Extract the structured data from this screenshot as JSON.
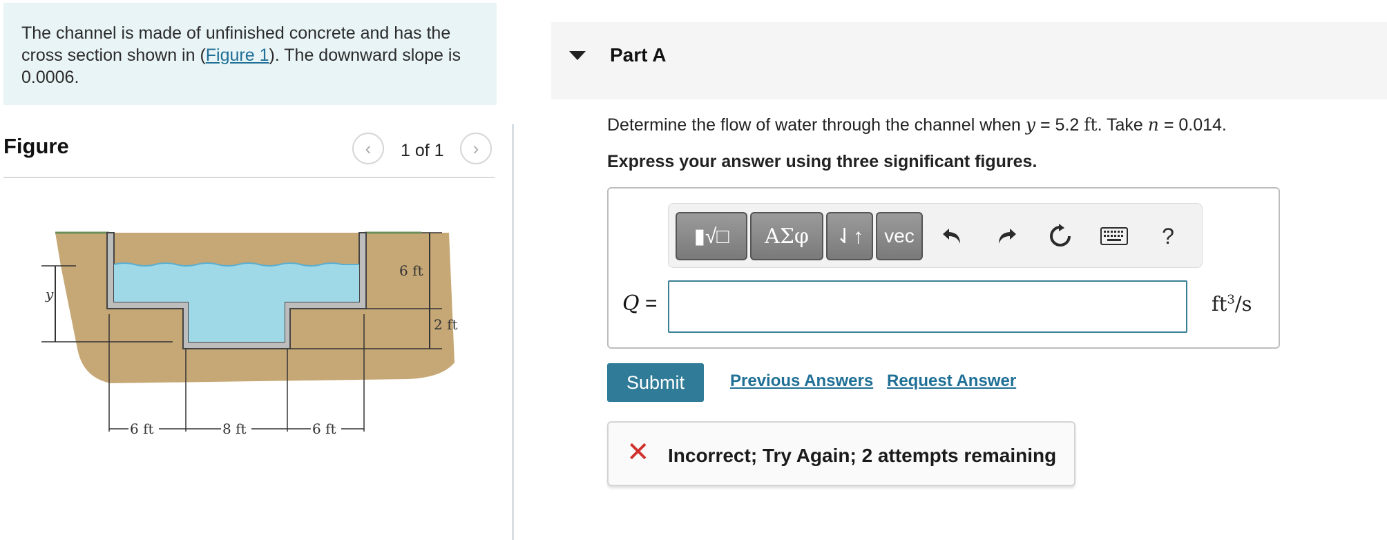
{
  "problem": {
    "text_before": "The channel is made of unfinished concrete and has the cross section shown in (",
    "figure_link": "Figure 1",
    "text_after": "). The downward slope is 0.0006."
  },
  "figure": {
    "title": "Figure",
    "pager": "1 of 1",
    "prev_icon": "‹",
    "next_icon": "›",
    "labels": {
      "y": "y",
      "depth_upper": "6 ft",
      "depth_lower": "2 ft",
      "width_left": "6 ft",
      "width_middle": "8 ft",
      "width_right": "6 ft"
    },
    "colors": {
      "water": "#9fd8e6",
      "soil": "#c6a876",
      "concrete": "#bdbdbd"
    }
  },
  "part": {
    "title": "Part A",
    "question_before": "Determine the flow of water through the channel when ",
    "var_y": "y",
    "eq_y": " = 5.2 ",
    "unit_y": "ft",
    "take": ". Take ",
    "var_n": "n",
    "eq_n": " = 0.014.",
    "instruction": "Express your answer using three significant figures."
  },
  "toolbar": {
    "templates_icon": "▮√□",
    "greek_label": "ΑΣφ",
    "updown_icon": "⇃↑",
    "vec_label": "vec",
    "undo_icon": "undo-icon",
    "redo_icon": "redo-icon",
    "reset_icon": "reset-icon",
    "keyboard_icon": "keyboard-icon",
    "help_label": "?"
  },
  "answer": {
    "var": "Q",
    "equals": " =",
    "value": "",
    "unit_base": "ft",
    "unit_exp": "3",
    "unit_tail": "/s"
  },
  "actions": {
    "submit": "Submit",
    "previous_answers": "Previous Answers",
    "request_answer": "Request Answer"
  },
  "feedback": {
    "icon": "✕",
    "message": "Incorrect; Try Again; 2 attempts remaining",
    "color": "#d0312d"
  },
  "accent": "#2f7b98"
}
